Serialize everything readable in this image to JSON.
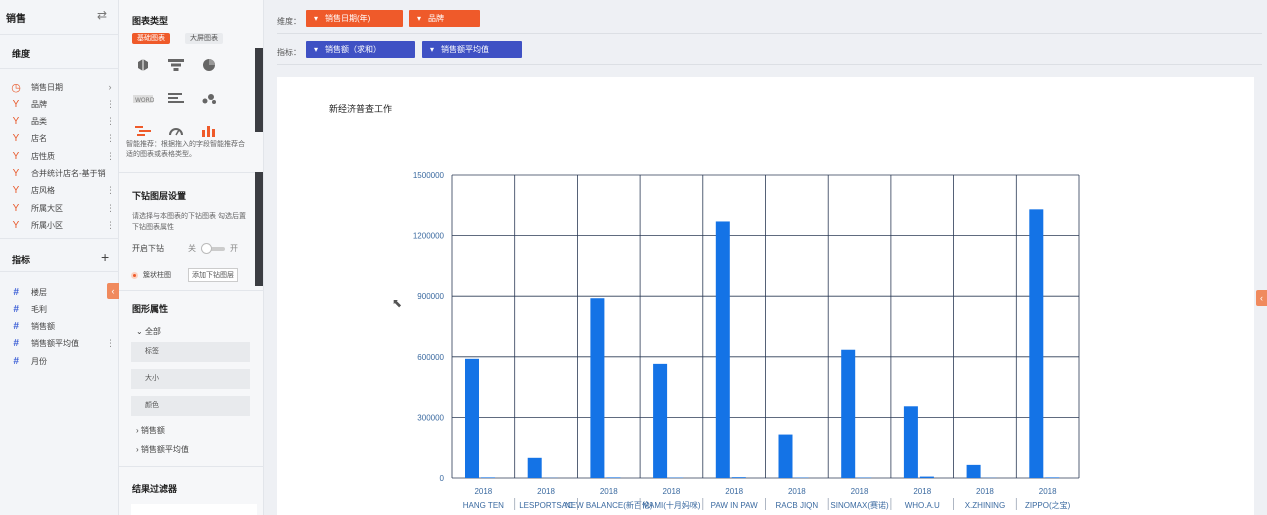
{
  "datasource": {
    "title": "销售"
  },
  "dimensions": {
    "label": "维度",
    "items": [
      {
        "name": "销售日期",
        "kind": "date",
        "suffix": "›"
      },
      {
        "name": "品牌",
        "kind": "dim",
        "suffix": "⋮"
      },
      {
        "name": "品类",
        "kind": "dim",
        "suffix": "⋮"
      },
      {
        "name": "店名",
        "kind": "dim",
        "suffix": "⋮"
      },
      {
        "name": "店性质",
        "kind": "dim",
        "suffix": "⋮"
      },
      {
        "name": "合并统计店名-基于销",
        "kind": "dim",
        "suffix": ""
      },
      {
        "name": "店风格",
        "kind": "dim",
        "suffix": "⋮"
      },
      {
        "name": "所属大区",
        "kind": "dim",
        "suffix": "⋮"
      },
      {
        "name": "所属小区",
        "kind": "dim",
        "suffix": "⋮"
      }
    ]
  },
  "measures": {
    "label": "指标",
    "items": [
      {
        "name": "楼层",
        "suffix": ""
      },
      {
        "name": "毛利",
        "suffix": ""
      },
      {
        "name": "销售额",
        "suffix": ""
      },
      {
        "name": "销售额平均值",
        "suffix": "⋮"
      },
      {
        "name": "月份",
        "suffix": ""
      }
    ]
  },
  "config": {
    "chart_type_title": "图表类型",
    "tab_basic": "基础图表",
    "tab_dashboard": "大屏图表",
    "note": "智能推荐：根据拖入的字段智能推荐合适的图表或表格类型。",
    "drill_title": "下钻图层设置",
    "drill_desc": "请选择与本图表的下钻图表 勾选后置下钻图表属性",
    "drill_toggle_label": "开启下钻",
    "toggle_off": "关",
    "toggle_on": "开",
    "layer_option": "簇状柱图",
    "add_layer": "添加下钻图层",
    "shape_title": "图形属性",
    "all_label": "全部",
    "attr_label": "标签",
    "attr_size": "大小",
    "attr_color": "颜色",
    "sub_sales": "销售额",
    "sub_avg": "销售额平均值",
    "filter_title": "结果过滤器"
  },
  "shelves": {
    "dim_label": "维度：",
    "measure_label": "指标：",
    "dim_chips": [
      "销售日期(年)",
      "品牌"
    ],
    "measure_chips": [
      "销售额（求和）",
      "销售额平均值"
    ]
  },
  "chart_data": {
    "type": "bar",
    "title": "新经济普查工作",
    "categories": [
      "HANG TEN",
      "LESPORTSAC",
      "NEW BALANCE(新百伦)",
      "MAMI(十月妈咪)",
      "PAW IN PAW",
      "RACB JIQN",
      "SINOMAX(赛诺)",
      "WHO.A.U",
      "X.ZHINING",
      "ZIPPO(之宝)"
    ],
    "year_label": "2018",
    "series": [
      {
        "values": [
          590000,
          100000,
          890000,
          565000,
          1270000,
          215000,
          635000,
          355000,
          65000,
          1330000
        ]
      },
      {
        "values": [
          3000,
          1000,
          3000,
          2000,
          4000,
          2000,
          2000,
          7000,
          1000,
          3000
        ]
      }
    ],
    "ylim": [
      0,
      1500000
    ],
    "yticks": [
      0,
      300000,
      600000,
      900000,
      1200000,
      1500000
    ],
    "grid": true,
    "colors": {
      "bar": "#1473e6",
      "axis_text": "#3b6aa0"
    }
  }
}
